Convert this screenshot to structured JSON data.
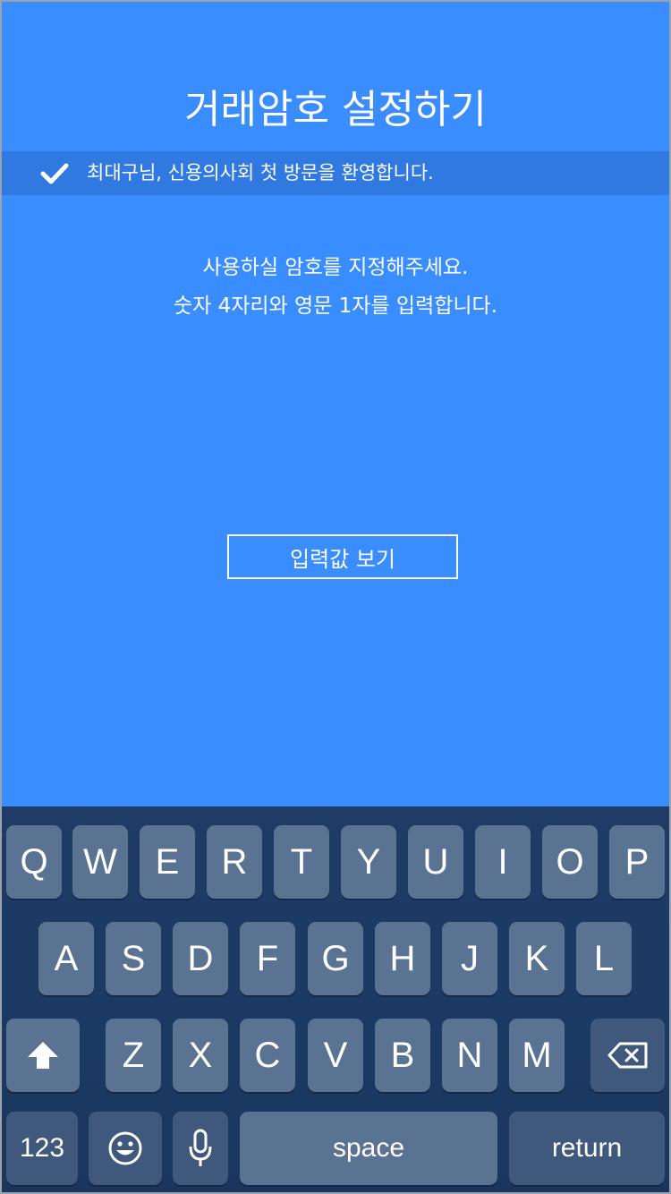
{
  "header": {
    "title": "거래암호 설정하기"
  },
  "welcome": {
    "message": "최대구님, 신용의사회 첫 방문을 환영합니다.",
    "icon": "check-icon"
  },
  "instructions": {
    "line1": "사용하실 암호를 지정해주세요.",
    "line2": "숫자 4자리와 영문 1자를 입력합니다."
  },
  "view_button": {
    "label": "입력값 보기"
  },
  "keyboard": {
    "row1": [
      "Q",
      "W",
      "E",
      "R",
      "T",
      "Y",
      "U",
      "I",
      "O",
      "P"
    ],
    "row2": [
      "A",
      "S",
      "D",
      "F",
      "G",
      "H",
      "J",
      "K",
      "L"
    ],
    "row3": [
      "Z",
      "X",
      "C",
      "V",
      "B",
      "N",
      "M"
    ],
    "shift_icon": "shift-arrow-icon",
    "delete_icon": "backspace-icon",
    "numbers_label": "123",
    "emoji_icon": "emoji-icon",
    "mic_icon": "microphone-icon",
    "space_label": "space",
    "return_label": "return"
  },
  "colors": {
    "background": "#3a8dff",
    "welcome_bar": "#2f79e0",
    "keyboard_bg": "#1f3b66",
    "key_bg": "#5b7393",
    "key_dark_bg": "#3f587c"
  }
}
